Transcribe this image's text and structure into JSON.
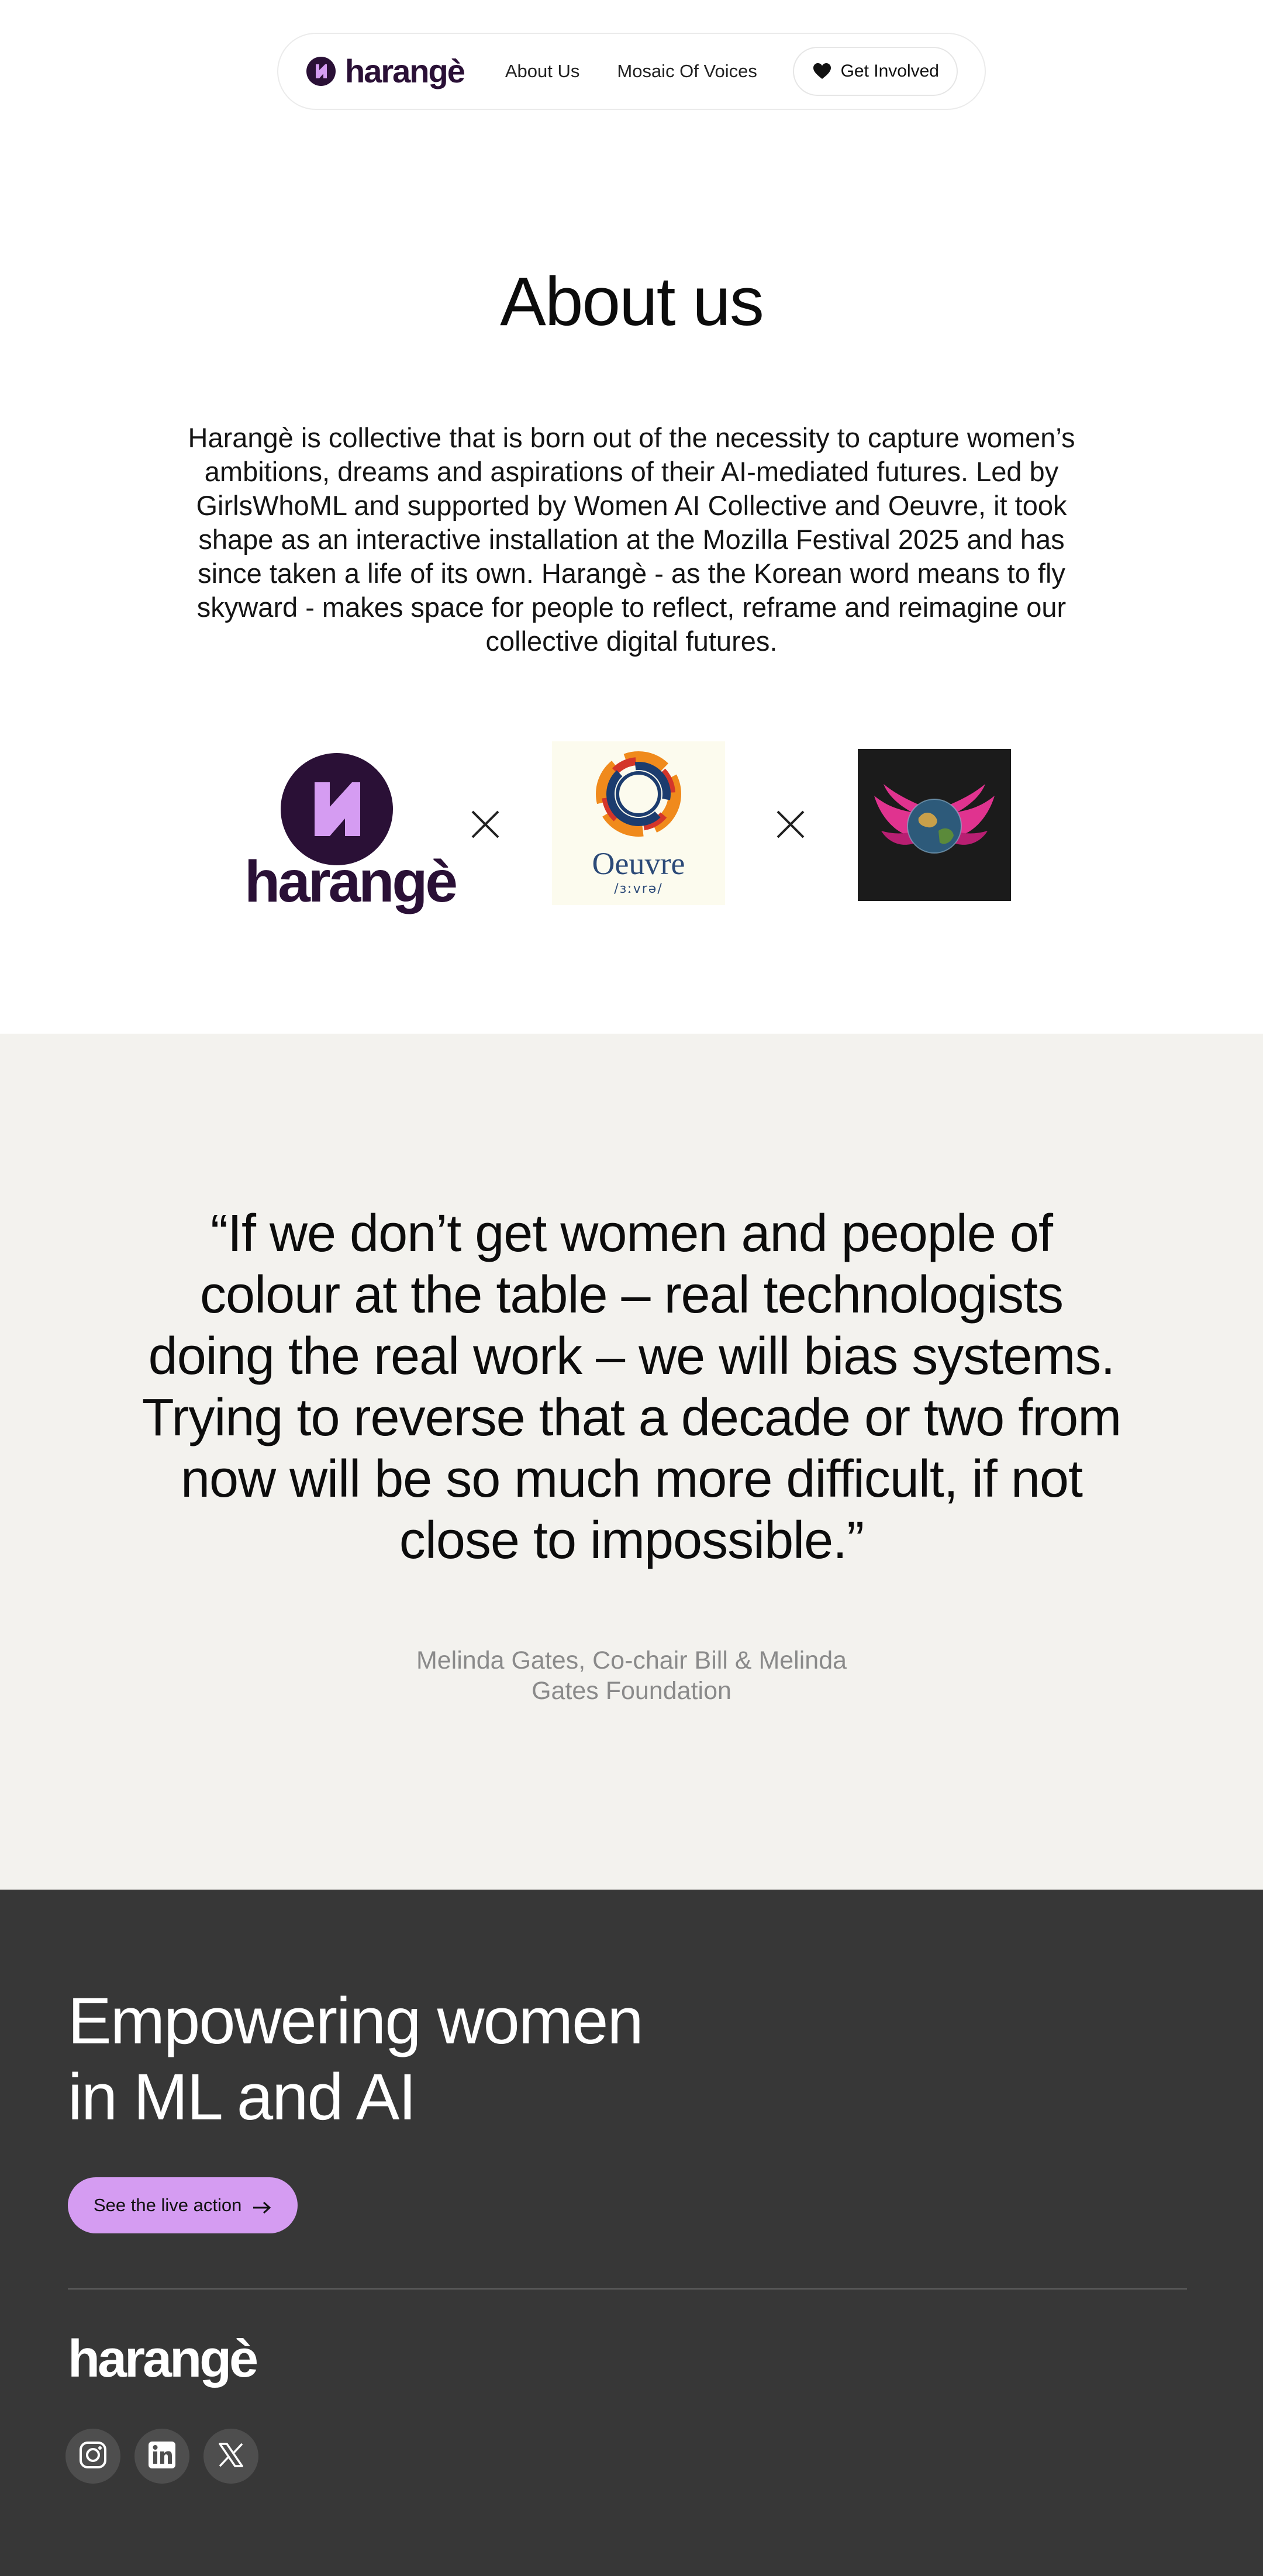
{
  "header": {
    "brand": "harangè",
    "nav_items": [
      {
        "label": "About Us"
      },
      {
        "label": "Mosaic Of Voices"
      }
    ],
    "cta_label": "Get Involved",
    "cta_icon": "heart-icon"
  },
  "about": {
    "title": "About us",
    "body": "Harangè is collective that is born out of the necessity to capture women’s ambitions, dreams and aspirations of their AI-mediated futures. Led by GirlsWhoML and supported by Women AI Collective and Oeuvre, it took shape as an interactive installation at the Mozilla Festival 2025 and has since taken a life of its own. Harangè - as the Korean word means to fly skyward - makes space for people to reflect, reframe and reimagine our collective digital futures."
  },
  "partners": {
    "harange_wordmark": "harangè",
    "oeuvre_wordmark": "Oeuvre",
    "oeuvre_phonetic": "/ɜːvrə/",
    "third_logo": "winged-globe-logo",
    "separator_icon": "cross-icon"
  },
  "quote": {
    "text": "“If we don’t get women and people of colour at the table – real technologists doing the real work – we will bias systems. Trying to reverse that a decade or two from now will be so much more difficult, if not close to impossible.”",
    "author": "Melinda Gates, Co-chair Bill & Melinda Gates Foundation"
  },
  "footer": {
    "headline_line1": "Empowering women",
    "headline_line2": "in ML and AI",
    "button_label": "See the live action",
    "button_icon": "arrow-right-icon",
    "logo": "harangè",
    "socials": [
      "instagram-icon",
      "linkedin-icon",
      "x-icon"
    ]
  },
  "colors": {
    "brand_purple": "#2a1036",
    "accent_lilac": "#d59cf2",
    "quote_bg": "#f3f2ee",
    "footer_bg": "#373737"
  }
}
